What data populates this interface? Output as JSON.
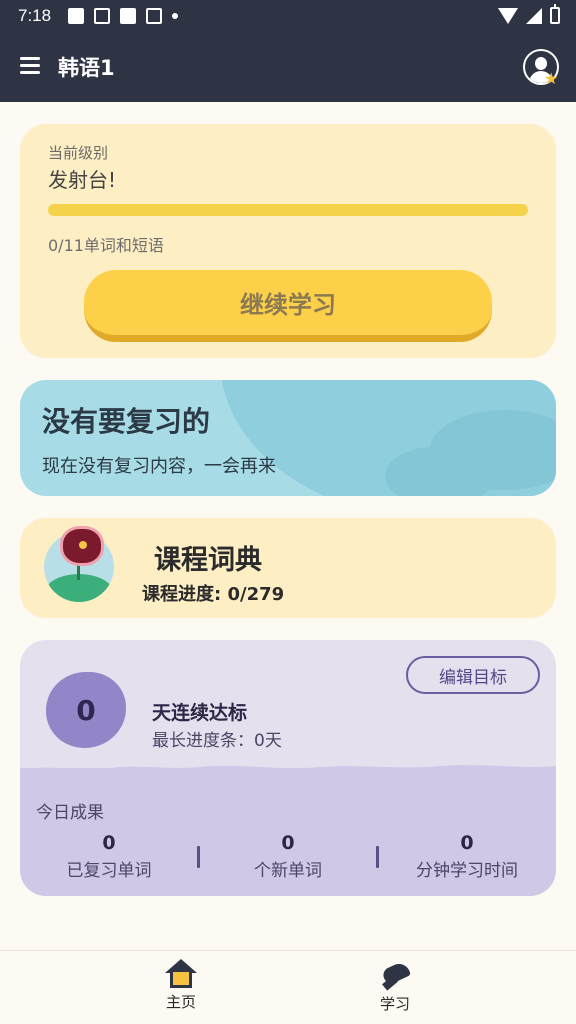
{
  "status_bar": {
    "time": "7:18"
  },
  "app_bar": {
    "title": "韩语1"
  },
  "level_card": {
    "label": "当前级别",
    "level_name": "发射台!",
    "progress": 0,
    "progress_text": "0/11单词和短语",
    "continue_label": "继续学习"
  },
  "review_card": {
    "title": "没有要复习的",
    "subtitle": "现在没有复习内容，一会再来"
  },
  "dictionary_card": {
    "title": "课程词典",
    "progress": "课程进度: 0/279"
  },
  "goal_card": {
    "streak_count": "0",
    "edit_label": "编辑目标",
    "streak_label": "天连续达标",
    "longest_streak": "最长进度条：0天",
    "today_label": "今日成果",
    "stats": [
      {
        "value": "0",
        "label": "已复习单词"
      },
      {
        "value": "0",
        "label": "个新单词"
      },
      {
        "value": "0",
        "label": "分钟学习时间"
      }
    ]
  },
  "bottom_nav": {
    "items": [
      {
        "label": "主页",
        "icon": "home-icon"
      },
      {
        "label": "学习",
        "icon": "learn-icon"
      }
    ]
  },
  "colors": {
    "header": "#2e3444",
    "accent_yellow": "#fdd04a",
    "review_blue": "#a7dbe6",
    "goal_purple": "#d0c8e6"
  }
}
